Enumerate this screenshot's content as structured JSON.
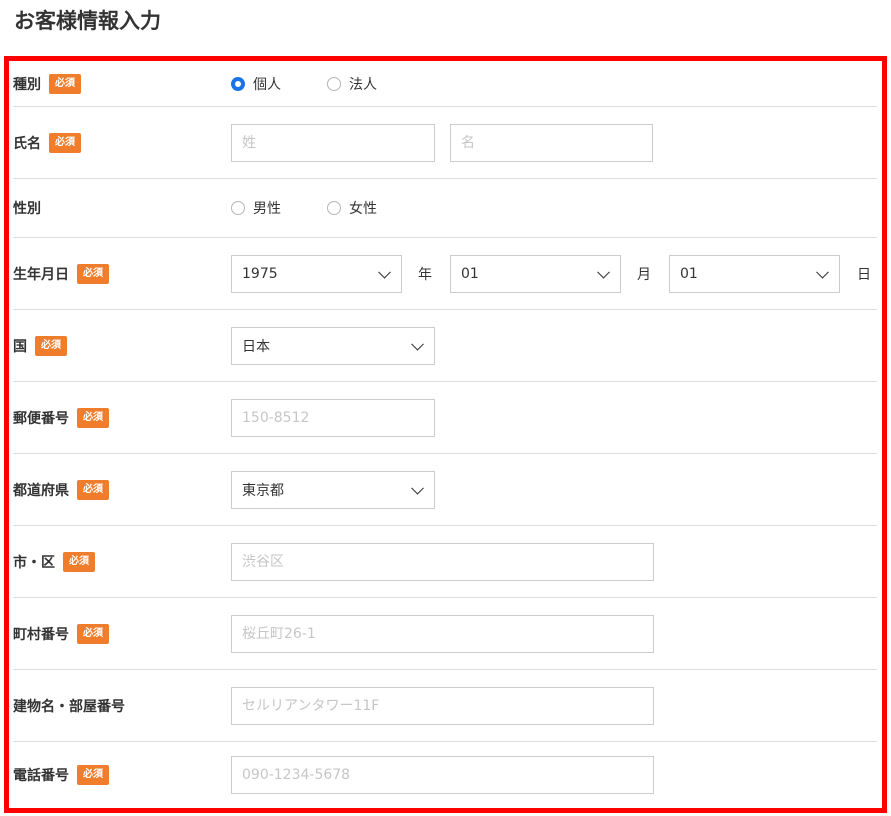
{
  "page": {
    "title": "お客様情報入力"
  },
  "required_badge": "必須",
  "type_row": {
    "label": "種別",
    "options": [
      {
        "label": "個人",
        "checked": true
      },
      {
        "label": "法人",
        "checked": false
      }
    ]
  },
  "name_row": {
    "label": "氏名",
    "last_placeholder": "姓",
    "first_placeholder": "名"
  },
  "gender_row": {
    "label": "性別",
    "options": [
      {
        "label": "男性",
        "checked": false
      },
      {
        "label": "女性",
        "checked": false
      }
    ]
  },
  "birth_row": {
    "label": "生年月日",
    "year_value": "1975",
    "year_unit": "年",
    "month_value": "01",
    "month_unit": "月",
    "day_value": "01",
    "day_unit": "日"
  },
  "country_row": {
    "label": "国",
    "value": "日本"
  },
  "postal_row": {
    "label": "郵便番号",
    "placeholder": "150-8512"
  },
  "prefecture_row": {
    "label": "都道府県",
    "value": "東京都"
  },
  "city_row": {
    "label": "市・区",
    "placeholder": "渋谷区"
  },
  "street_row": {
    "label": "町村番号",
    "placeholder": "桜丘町26-1"
  },
  "building_row": {
    "label": "建物名・部屋番号",
    "placeholder": "セルリアンタワー11F"
  },
  "phone_row": {
    "label": "電話番号",
    "placeholder": "090-1234-5678"
  },
  "colors": {
    "badge": "#f07d2c",
    "frame": "#ff0000",
    "radio_checked": "#1a73e8"
  }
}
